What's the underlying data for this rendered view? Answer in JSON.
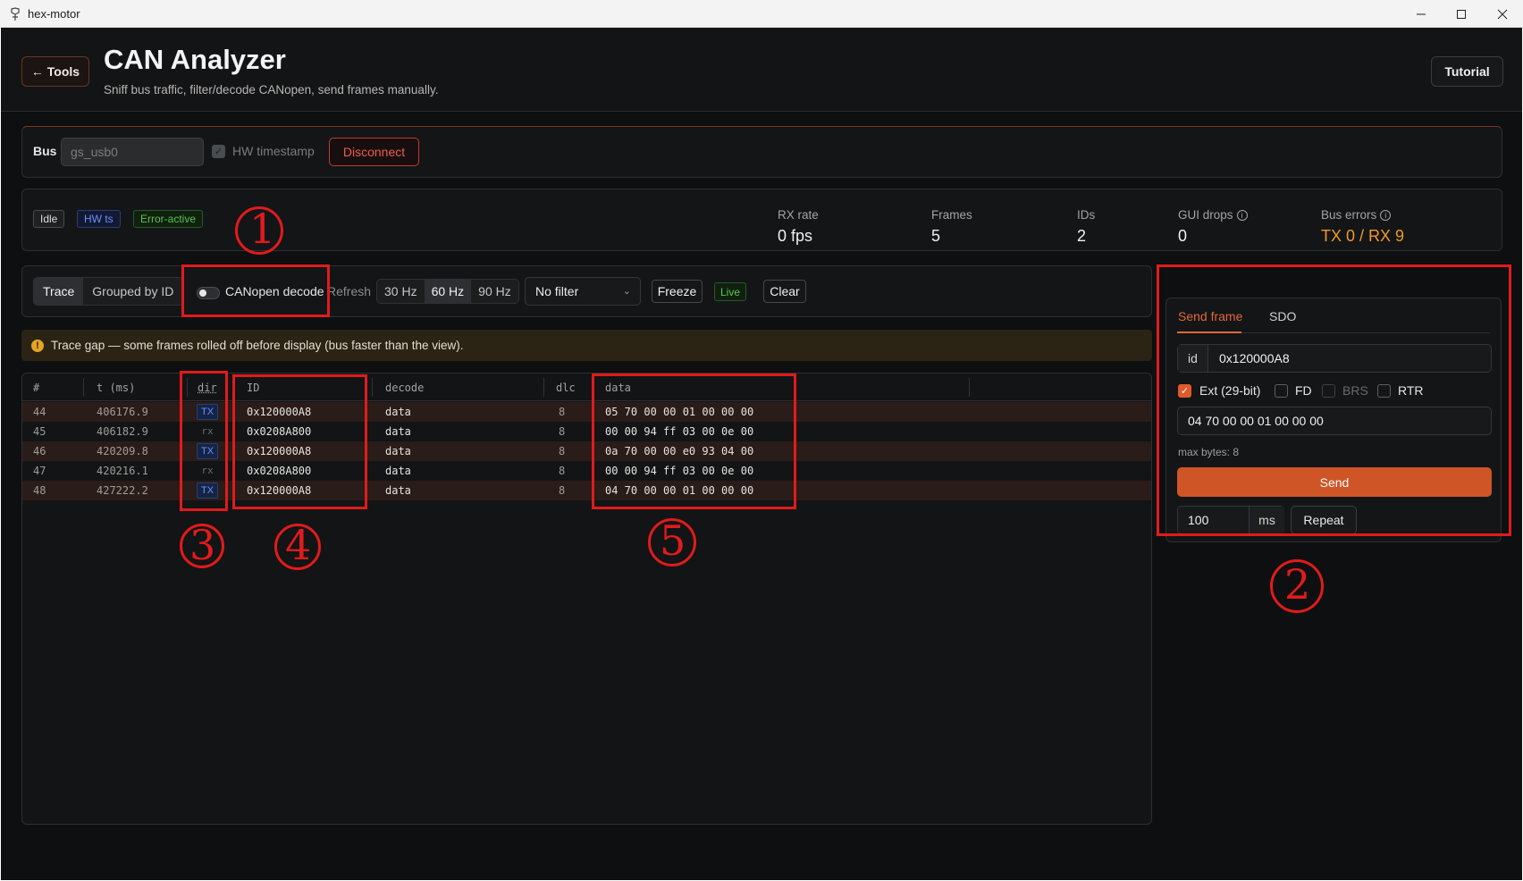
{
  "window": {
    "title": "hex-motor",
    "minimize": "—",
    "maximize": "☐",
    "close": "✕"
  },
  "header": {
    "back_label": "← Tools",
    "title": "CAN Analyzer",
    "subtitle": "Sniff bus traffic, filter/decode CANopen, send frames manually.",
    "tutorial_label": "Tutorial"
  },
  "bus": {
    "label": "Bus",
    "interface_value": "gs_usb0",
    "hw_timestamp_label": "HW timestamp",
    "hw_timestamp_checked": true,
    "disconnect_label": "Disconnect"
  },
  "status": {
    "badges": [
      "Idle",
      "HW ts",
      "Error-active"
    ],
    "stats": [
      {
        "label": "RX rate",
        "value": "0 fps"
      },
      {
        "label": "Frames",
        "value": "5"
      },
      {
        "label": "IDs",
        "value": "2"
      },
      {
        "label": "GUI drops",
        "value": "0"
      },
      {
        "label": "Bus errors",
        "value": "TX 0 / RX 9"
      }
    ]
  },
  "toolbar": {
    "view_modes": [
      "Trace",
      "Grouped by ID"
    ],
    "active_view": "Trace",
    "canopen_label": "CANopen decode",
    "canopen_enabled": false,
    "refresh_label": "Refresh",
    "refresh_rates": [
      "30 Hz",
      "60 Hz",
      "90 Hz"
    ],
    "active_rate": "60 Hz",
    "filter_value": "No filter",
    "freeze_label": "Freeze",
    "live_label": "Live",
    "clear_label": "Clear"
  },
  "warning": {
    "icon": "!",
    "text": "Trace gap — some frames rolled off before display (bus faster than the view)."
  },
  "trace": {
    "columns": [
      "#",
      "t (ms)",
      "dir",
      "ID",
      "decode",
      "dlc",
      "data"
    ],
    "rows": [
      {
        "n": "44",
        "t": "406176.9",
        "dir": "TX",
        "id": "0x120000A8",
        "decode": "data",
        "dlc": "8",
        "data": "05 70 00 00 01 00 00 00"
      },
      {
        "n": "45",
        "t": "406182.9",
        "dir": "rx",
        "id": "0x0208A800",
        "decode": "data",
        "dlc": "8",
        "data": "00 00 94 ff 03 00 0e 00"
      },
      {
        "n": "46",
        "t": "420209.8",
        "dir": "TX",
        "id": "0x120000A8",
        "decode": "data",
        "dlc": "8",
        "data": "0a 70 00 00 e0 93 04 00"
      },
      {
        "n": "47",
        "t": "420216.1",
        "dir": "rx",
        "id": "0x0208A800",
        "decode": "data",
        "dlc": "8",
        "data": "00 00 94 ff 03 00 0e 00"
      },
      {
        "n": "48",
        "t": "427222.2",
        "dir": "TX",
        "id": "0x120000A8",
        "decode": "data",
        "dlc": "8",
        "data": "04 70 00 00 01 00 00 00"
      }
    ]
  },
  "send": {
    "tabs": [
      "Send frame",
      "SDO"
    ],
    "active_tab": "Send frame",
    "id_prefix": "id",
    "id_value": "0x120000A8",
    "flags": [
      {
        "label": "Ext (29-bit)",
        "checked": true,
        "disabled": false
      },
      {
        "label": "FD",
        "checked": false,
        "disabled": false
      },
      {
        "label": "BRS",
        "checked": false,
        "disabled": true
      },
      {
        "label": "RTR",
        "checked": false,
        "disabled": false
      }
    ],
    "data_value": "04 70 00 00 01 00 00 00",
    "max_bytes": "max bytes: 8",
    "send_label": "Send",
    "period_value": "100",
    "period_unit": "ms",
    "repeat_label": "Repeat"
  },
  "annotations": [
    "1",
    "2",
    "3",
    "4",
    "5"
  ],
  "colors": {
    "accent": "#cf5526",
    "annotation": "#e11b1b",
    "bus_errors": "#f09a26",
    "tx_row": "#2a1c19"
  }
}
